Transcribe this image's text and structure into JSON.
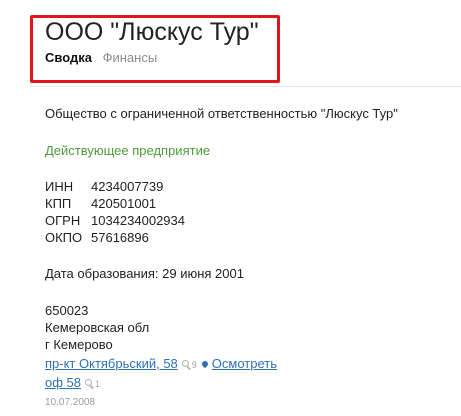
{
  "header": {
    "company_name": "ООО \"Люскус Тур\"",
    "tabs": [
      {
        "label": "Сводка",
        "active": true
      },
      {
        "label": "Финансы",
        "active": false
      }
    ]
  },
  "main": {
    "full_name": "Общество с ограниченной ответственностью \"Люскус Тур\"",
    "status": "Действующее предприятие",
    "codes": [
      {
        "label": "ИНН",
        "value": "4234007739"
      },
      {
        "label": "КПП",
        "value": "420501001"
      },
      {
        "label": "ОГРН",
        "value": "1034234002934"
      },
      {
        "label": "ОКПО",
        "value": "57616896"
      }
    ],
    "founded_label": "Дата образования:",
    "founded_date": "29 июня 2001",
    "address": {
      "postal_code": "650023",
      "region": "Кемеровская обл",
      "city": "г Кемерово",
      "street_link": "пр-кт Октябрьский, 58",
      "street_count": "9",
      "map_link": "Осмотреть",
      "office_link": "оф 58",
      "office_count": "1"
    },
    "updated_date": "10.07.2008"
  },
  "colors": {
    "highlight_border": "#e3151a",
    "status_green": "#4d9b3a",
    "link_blue": "#2f6fb4"
  }
}
